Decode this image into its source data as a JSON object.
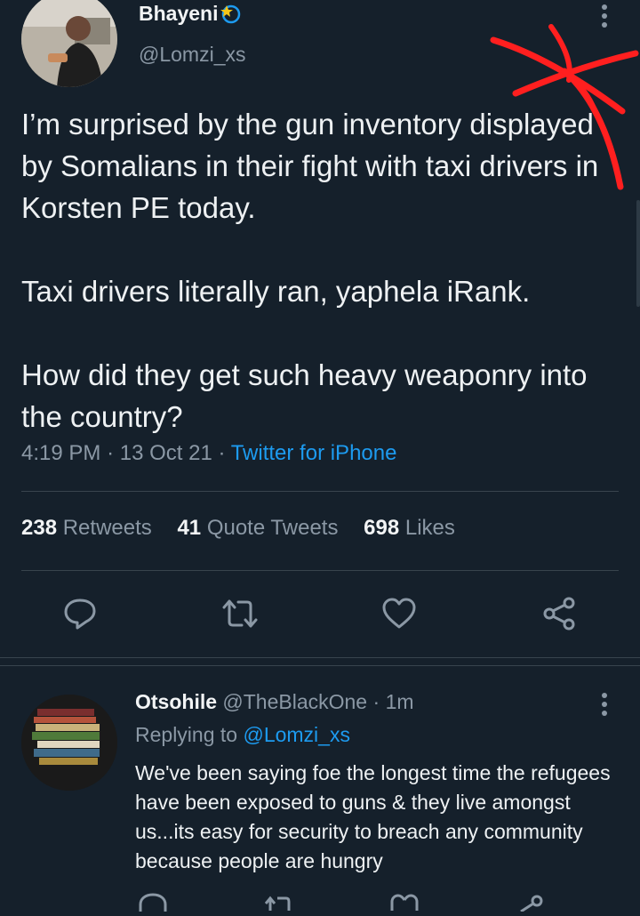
{
  "tweet": {
    "display_name": "Bhayeni",
    "handle": "@Lomzi_xs",
    "text": "I’m surprised by the gun inventory displayed by Somalians in their fight with taxi drivers in Korsten PE today.\n\nTaxi drivers literally ran, yaphela iRank.\n\nHow did they get such heavy weaponry into the country?",
    "time": "4:19 PM",
    "date": "13 Oct 21",
    "source": "Twitter for iPhone",
    "stats": {
      "retweets_count": "238",
      "retweets_label": "Retweets",
      "quotes_count": "41",
      "quotes_label": "Quote Tweets",
      "likes_count": "698",
      "likes_label": "Likes"
    }
  },
  "reply": {
    "display_name": "Otsohile",
    "handle": "@TheBlackOne",
    "time": "1m",
    "replying_prefix": "Replying to",
    "replying_to": "@Lomzi_xs",
    "text": "We've been saying foe the longest time the refugees have been exposed to guns & they live amongst us...its easy for security to breach any community because people are hungry"
  },
  "icons": {
    "verified": "emoji-badge-icon",
    "reply": "reply-icon",
    "retweet": "retweet-icon",
    "like": "heart-icon",
    "share": "share-icon",
    "more": "more-vertical-icon"
  },
  "colors": {
    "background": "#15202b",
    "accent": "#1d9bf0",
    "muted": "#8b98a5",
    "annotation": "#ff1f1f"
  }
}
